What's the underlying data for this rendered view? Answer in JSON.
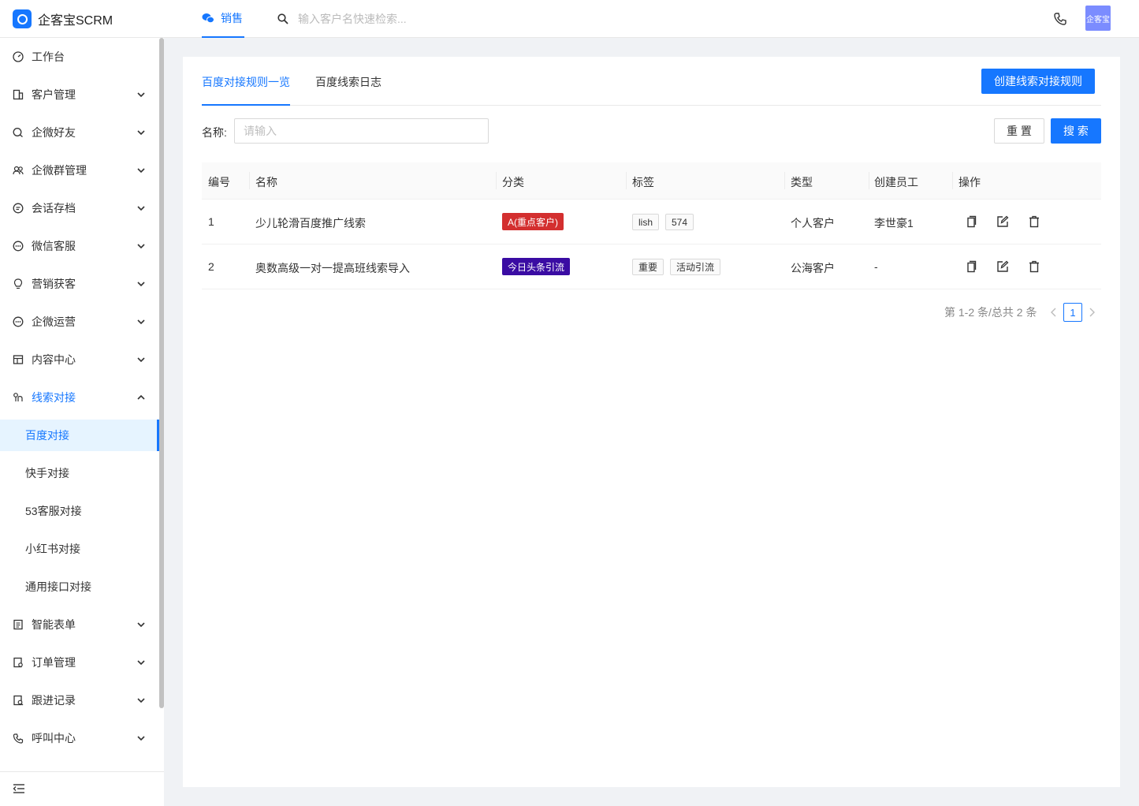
{
  "app": {
    "name": "企客宝SCRM",
    "avatar_text": "企客宝"
  },
  "topnav": {
    "active_module": "销售",
    "search_placeholder": "输入客户名快速检索..."
  },
  "sidebar": {
    "items": [
      {
        "label": "工作台",
        "icon": "dashboard-icon"
      },
      {
        "label": "客户管理",
        "icon": "building-icon"
      },
      {
        "label": "企微好友",
        "icon": "chat-icon"
      },
      {
        "label": "企微群管理",
        "icon": "group-icon"
      },
      {
        "label": "会话存档",
        "icon": "message-icon"
      },
      {
        "label": "微信客服",
        "icon": "service-icon"
      },
      {
        "label": "营销获客",
        "icon": "bulb-icon"
      },
      {
        "label": "企微运营",
        "icon": "ops-icon"
      },
      {
        "label": "内容中心",
        "icon": "content-icon"
      },
      {
        "label": "线索对接",
        "icon": "link-icon"
      },
      {
        "label": "智能表单",
        "icon": "form-icon"
      },
      {
        "label": "订单管理",
        "icon": "order-icon"
      },
      {
        "label": "跟进记录",
        "icon": "record-icon"
      },
      {
        "label": "呼叫中心",
        "icon": "phone-icon"
      }
    ],
    "sub_items": [
      "百度对接",
      "快手对接",
      "53客服对接",
      "小红书对接",
      "通用接口对接"
    ],
    "active_sub": "百度对接"
  },
  "tabs": [
    "百度对接规则一览",
    "百度线索日志"
  ],
  "create_button": "创建线索对接规则",
  "filter": {
    "label": "名称:",
    "placeholder": "请输入",
    "reset": "重 置",
    "search": "搜 索"
  },
  "table": {
    "headers": [
      "编号",
      "名称",
      "分类",
      "标签",
      "类型",
      "创建员工",
      "操作"
    ],
    "rows": [
      {
        "id": "1",
        "name": "少儿轮滑百度推广线索",
        "category": "A(重点客户)",
        "category_color": "#d32f2f",
        "tags": [
          "lish",
          "574"
        ],
        "type": "个人客户",
        "creator": "李世豪1"
      },
      {
        "id": "2",
        "name": "奥数高级一对一提高班线索导入",
        "category": "今日头条引流",
        "category_color": "#3a0ca3",
        "tags": [
          "重要",
          "活动引流"
        ],
        "type": "公海客户",
        "creator": "-"
      }
    ]
  },
  "pagination": {
    "summary": "第 1-2 条/总共 2 条",
    "current_page": "1"
  },
  "colors": {
    "accent": "#1677ff"
  }
}
